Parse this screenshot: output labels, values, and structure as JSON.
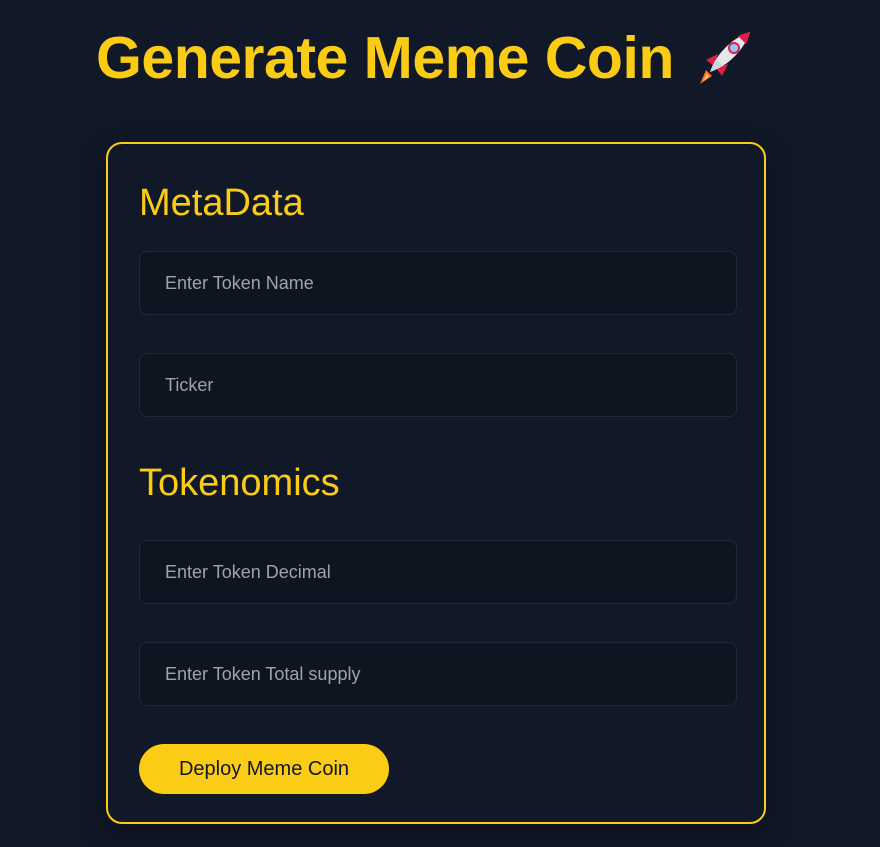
{
  "header": {
    "title": "Generate Meme Coin",
    "icon": "rocket-icon"
  },
  "form": {
    "metadata_title": "MetaData",
    "token_name_placeholder": "Enter Token Name",
    "ticker_placeholder": "Ticker",
    "tokenomics_title": "Tokenomics",
    "token_decimal_placeholder": "Enter Token Decimal",
    "total_supply_placeholder": "Enter Token Total supply",
    "deploy_label": "Deploy Meme Coin"
  },
  "colors": {
    "background": "#111827",
    "accent": "#facc15",
    "field_background": "#0f1520",
    "field_border": "#1f2937",
    "placeholder": "#9ca3af"
  }
}
